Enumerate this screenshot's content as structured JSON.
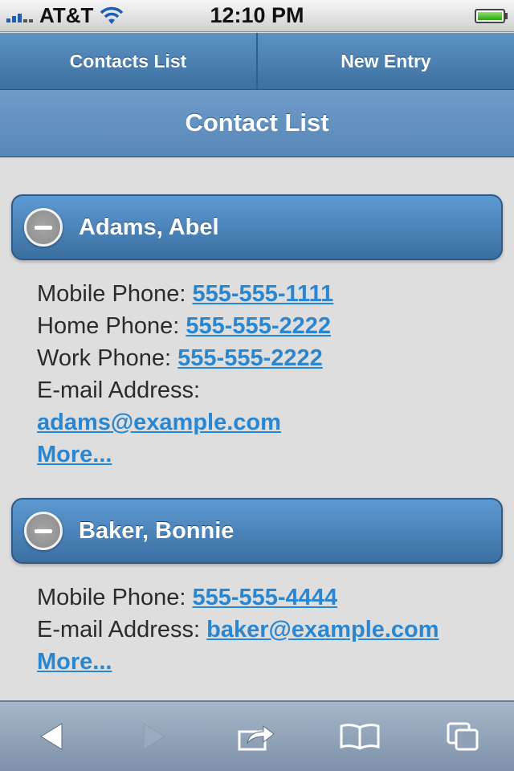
{
  "status_bar": {
    "carrier": "AT&T",
    "time": "12:10 PM"
  },
  "nav": {
    "tabs": [
      {
        "label": "Contacts List"
      },
      {
        "label": "New Entry"
      }
    ]
  },
  "header": {
    "title": "Contact List"
  },
  "contacts": [
    {
      "name": "Adams, Abel",
      "fields": {
        "mobile_label": "Mobile Phone: ",
        "mobile": "555-555-1111",
        "home_label": "Home Phone: ",
        "home": "555-555-2222",
        "work_label": "Work Phone: ",
        "work": "555-555-2222",
        "email_label": "E-mail Address:",
        "email": "adams@example.com",
        "more": "More..."
      }
    },
    {
      "name": "Baker, Bonnie",
      "fields": {
        "mobile_label": "Mobile Phone: ",
        "mobile": "555-555-4444",
        "email_label": "E-mail Address: ",
        "email": "baker@example.com",
        "more": "More..."
      }
    }
  ],
  "toolbar": {
    "icons": [
      "back-icon",
      "forward-icon",
      "share-icon",
      "bookmarks-icon",
      "tabs-icon"
    ]
  },
  "colors": {
    "accent_blue": "#4a84bb",
    "link_blue": "#2a86d0",
    "background": "#dedede"
  }
}
